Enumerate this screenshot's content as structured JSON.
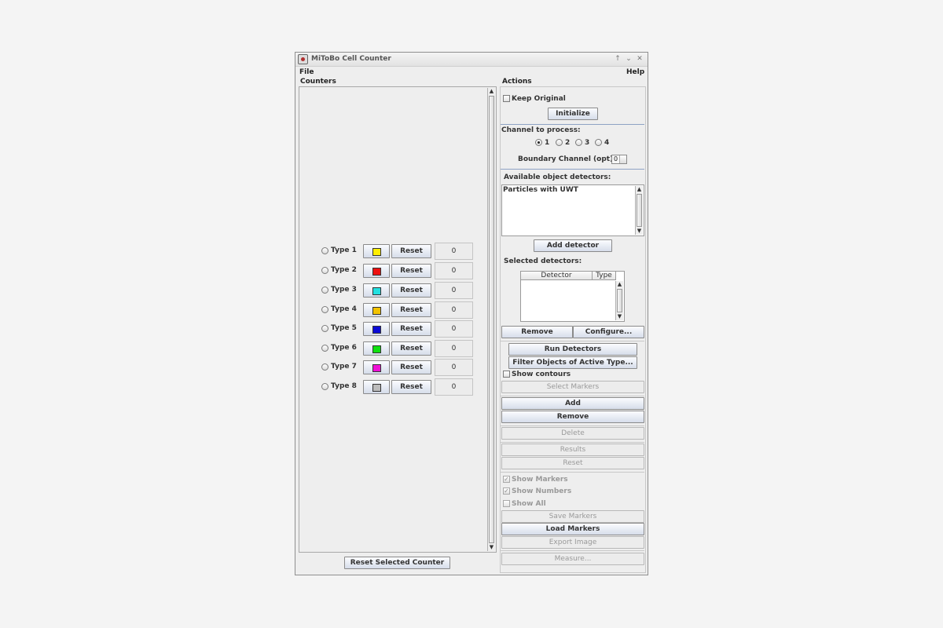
{
  "window": {
    "title": "MiToBo Cell Counter",
    "controls": {
      "maximize": "↑",
      "minimize": "⌄",
      "close": "✕"
    }
  },
  "menu": {
    "file": "File",
    "help": "Help"
  },
  "counters": {
    "title": "Counters",
    "rows": [
      {
        "label": "Type 1",
        "color": "#ffee00",
        "reset": "Reset",
        "count": "0"
      },
      {
        "label": "Type 2",
        "color": "#ee1111",
        "reset": "Reset",
        "count": "0"
      },
      {
        "label": "Type 3",
        "color": "#22e0e0",
        "reset": "Reset",
        "count": "0"
      },
      {
        "label": "Type 4",
        "color": "#f2c200",
        "reset": "Reset",
        "count": "0"
      },
      {
        "label": "Type 5",
        "color": "#0a0ad6",
        "reset": "Reset",
        "count": "0"
      },
      {
        "label": "Type 6",
        "color": "#10e010",
        "reset": "Reset",
        "count": "0"
      },
      {
        "label": "Type 7",
        "color": "#ee10d6",
        "reset": "Reset",
        "count": "0"
      },
      {
        "label": "Type 8",
        "color": "#bcbcbc",
        "reset": "Reset",
        "count": "0"
      }
    ],
    "reset_selected": "Reset Selected Counter"
  },
  "actions": {
    "title": "Actions",
    "keep_original": "Keep Original",
    "initialize": "Initialize",
    "channel_label": "Channel to process:",
    "channels": [
      "1",
      "2",
      "3",
      "4"
    ],
    "selected_channel": "1",
    "boundary_label": "Boundary Channel (opt):",
    "boundary_value": "0",
    "available_label": "Available object detectors:",
    "available_items": [
      "Particles with UWT"
    ],
    "add_detector": "Add detector",
    "selected_label": "Selected detectors:",
    "table_headers": [
      "Detector",
      "Type"
    ],
    "remove": "Remove",
    "configure": "Configure...",
    "run_detectors": "Run Detectors",
    "filter_objects": "Filter Objects of Active Type...",
    "show_contours": "Show contours",
    "select_markers": "Select Markers",
    "add": "Add",
    "remove2": "Remove",
    "delete": "Delete",
    "results": "Results",
    "reset": "Reset",
    "show_markers": "Show Markers",
    "show_numbers": "Show Numbers",
    "show_all": "Show All",
    "save_markers": "Save Markers",
    "load_markers": "Load Markers",
    "export_image": "Export Image",
    "measure": "Measure..."
  }
}
